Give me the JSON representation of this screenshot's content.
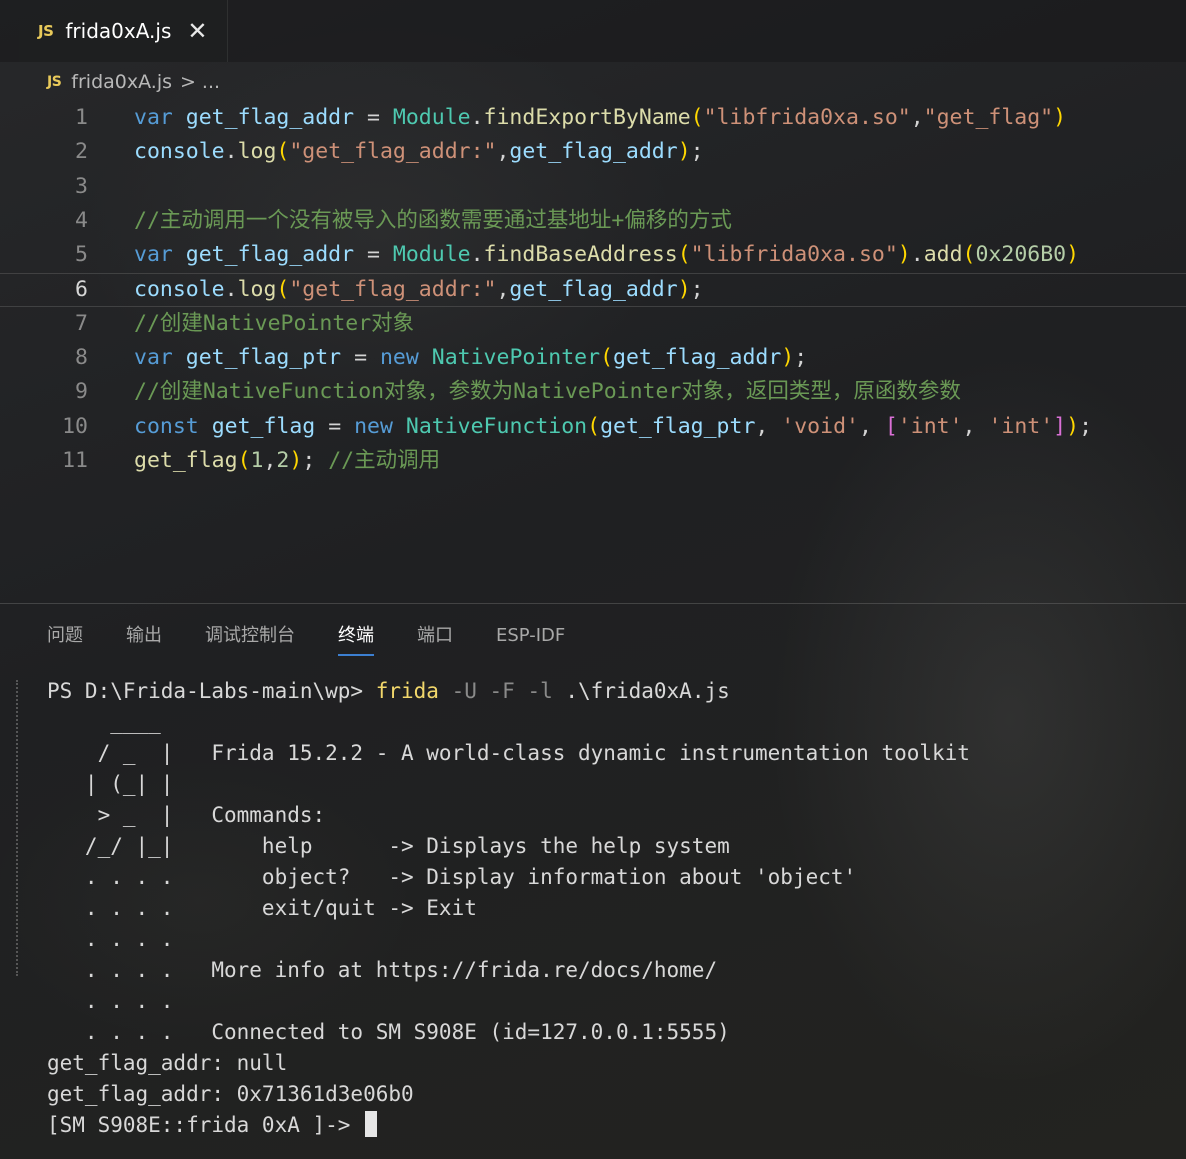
{
  "tab": {
    "icon": "JS",
    "title": "frida0xA.js",
    "close_glyph": "✕"
  },
  "breadcrumb": {
    "icon": "JS",
    "file": "frida0xA.js",
    "separator": ">",
    "more": "..."
  },
  "editor": {
    "current_line": 6,
    "lines": [
      {
        "n": "1",
        "tokens": [
          [
            "kw",
            "var"
          ],
          [
            "pn",
            " "
          ],
          [
            "vr",
            "get_flag_addr"
          ],
          [
            "pn",
            " = "
          ],
          [
            "cls",
            "Module"
          ],
          [
            "pn",
            "."
          ],
          [
            "fn",
            "findExportByName"
          ],
          [
            "br1",
            "("
          ],
          [
            "str",
            "\"libfrida0xa.so\""
          ],
          [
            "pn",
            ","
          ],
          [
            "str",
            "\"get_flag\""
          ],
          [
            "br1",
            ")"
          ]
        ]
      },
      {
        "n": "2",
        "tokens": [
          [
            "vr",
            "console"
          ],
          [
            "pn",
            "."
          ],
          [
            "fn",
            "log"
          ],
          [
            "br1",
            "("
          ],
          [
            "str",
            "\"get_flag_addr:\""
          ],
          [
            "pn",
            ","
          ],
          [
            "vr",
            "get_flag_addr"
          ],
          [
            "br1",
            ")"
          ],
          [
            "pn",
            ";"
          ]
        ]
      },
      {
        "n": "3",
        "tokens": []
      },
      {
        "n": "4",
        "tokens": [
          [
            "cm",
            "//主动调用一个没有被导入的函数需要通过基地址+偏移的方式"
          ]
        ]
      },
      {
        "n": "5",
        "tokens": [
          [
            "kw",
            "var"
          ],
          [
            "pn",
            " "
          ],
          [
            "vr",
            "get_flag_addr"
          ],
          [
            "pn",
            " = "
          ],
          [
            "cls",
            "Module"
          ],
          [
            "pn",
            "."
          ],
          [
            "fn",
            "findBaseAddress"
          ],
          [
            "br1",
            "("
          ],
          [
            "str",
            "\"libfrida0xa.so\""
          ],
          [
            "br1",
            ")"
          ],
          [
            "pn",
            "."
          ],
          [
            "fn",
            "add"
          ],
          [
            "br1",
            "("
          ],
          [
            "num",
            "0x206B0"
          ],
          [
            "br1",
            ")"
          ]
        ]
      },
      {
        "n": "6",
        "tokens": [
          [
            "vr",
            "console"
          ],
          [
            "pn",
            "."
          ],
          [
            "fn",
            "log"
          ],
          [
            "br1",
            "("
          ],
          [
            "str",
            "\"get_flag_addr:\""
          ],
          [
            "pn",
            ","
          ],
          [
            "vr",
            "get_flag_addr"
          ],
          [
            "br1",
            ")"
          ],
          [
            "pn",
            ";"
          ]
        ]
      },
      {
        "n": "7",
        "tokens": [
          [
            "cm",
            "//创建NativePointer对象"
          ]
        ]
      },
      {
        "n": "8",
        "tokens": [
          [
            "kw",
            "var"
          ],
          [
            "pn",
            " "
          ],
          [
            "vr",
            "get_flag_ptr"
          ],
          [
            "pn",
            " = "
          ],
          [
            "kw",
            "new"
          ],
          [
            "pn",
            " "
          ],
          [
            "cls",
            "NativePointer"
          ],
          [
            "br1",
            "("
          ],
          [
            "vr",
            "get_flag_addr"
          ],
          [
            "br1",
            ")"
          ],
          [
            "pn",
            ";"
          ]
        ]
      },
      {
        "n": "9",
        "tokens": [
          [
            "cm",
            "//创建NativeFunction对象，参数为NativePointer对象，返回类型，原函数参数"
          ]
        ]
      },
      {
        "n": "10",
        "tokens": [
          [
            "kw",
            "const"
          ],
          [
            "pn",
            " "
          ],
          [
            "vr",
            "get_flag"
          ],
          [
            "pn",
            " = "
          ],
          [
            "kw",
            "new"
          ],
          [
            "pn",
            " "
          ],
          [
            "cls",
            "NativeFunction"
          ],
          [
            "br1",
            "("
          ],
          [
            "vr",
            "get_flag_ptr"
          ],
          [
            "pn",
            ", "
          ],
          [
            "str",
            "'void'"
          ],
          [
            "pn",
            ", "
          ],
          [
            "br2",
            "["
          ],
          [
            "str",
            "'int'"
          ],
          [
            "pn",
            ", "
          ],
          [
            "str",
            "'int'"
          ],
          [
            "br2",
            "]"
          ],
          [
            "br1",
            ")"
          ],
          [
            "pn",
            ";"
          ]
        ]
      },
      {
        "n": "11",
        "tokens": [
          [
            "fn",
            "get_flag"
          ],
          [
            "br1",
            "("
          ],
          [
            "num",
            "1"
          ],
          [
            "pn",
            ","
          ],
          [
            "num",
            "2"
          ],
          [
            "br1",
            ")"
          ],
          [
            "pn",
            "; "
          ],
          [
            "cm",
            "//主动调用"
          ]
        ]
      }
    ]
  },
  "panel": {
    "tabs": [
      {
        "label": "问题",
        "active": false
      },
      {
        "label": "输出",
        "active": false
      },
      {
        "label": "调试控制台",
        "active": false
      },
      {
        "label": "终端",
        "active": true
      },
      {
        "label": "端口",
        "active": false
      },
      {
        "label": "ESP-IDF",
        "active": false
      }
    ]
  },
  "terminal": {
    "prompt_prefix": "PS D:\\Frida-Labs-main\\wp> ",
    "prompt_cmd": "frida",
    "prompt_opts": " -U -F -l ",
    "prompt_arg": ".\\frida0xA.js",
    "lines": [
      "     ____",
      "    / _  |   Frida 15.2.2 - A world-class dynamic instrumentation toolkit",
      "   | (_| |",
      "    > _  |   Commands:",
      "   /_/ |_|       help      -> Displays the help system",
      "   . . . .       object?   -> Display information about 'object'",
      "   . . . .       exit/quit -> Exit",
      "   . . . .",
      "   . . . .   More info at https://frida.re/docs/home/",
      "   . . . .",
      "   . . . .   Connected to SM S908E (id=127.0.0.1:5555)",
      "get_flag_addr: null",
      "get_flag_addr: 0x71361d3e06b0"
    ],
    "repl_prompt": "[SM S908E::frida 0xA ]-> "
  }
}
